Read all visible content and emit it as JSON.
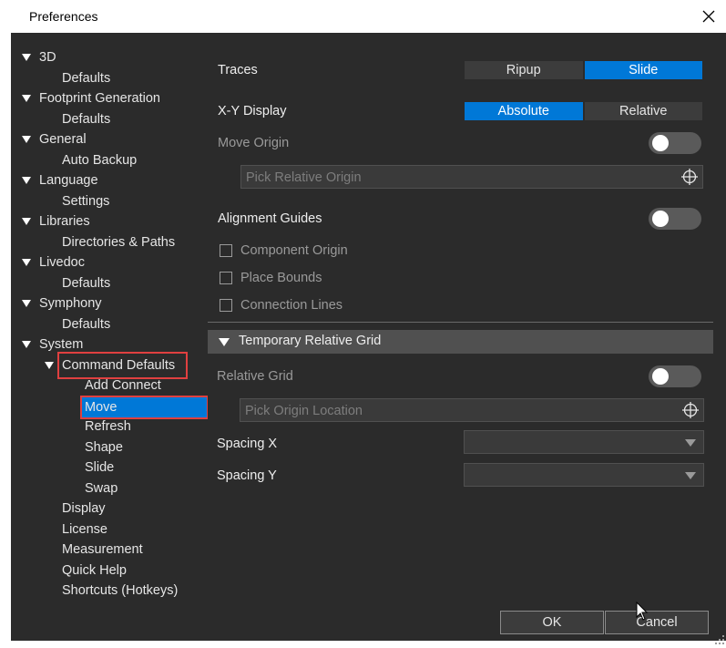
{
  "window": {
    "title": "Preferences"
  },
  "tree": {
    "items": [
      {
        "label": "3D"
      },
      {
        "label": "Defaults"
      },
      {
        "label": "Footprint Generation"
      },
      {
        "label": "Defaults"
      },
      {
        "label": "General"
      },
      {
        "label": "Auto Backup"
      },
      {
        "label": "Language"
      },
      {
        "label": "Settings"
      },
      {
        "label": "Libraries"
      },
      {
        "label": "Directories & Paths"
      },
      {
        "label": "Livedoc"
      },
      {
        "label": "Defaults"
      },
      {
        "label": "Symphony"
      },
      {
        "label": "Defaults"
      },
      {
        "label": "System"
      },
      {
        "label": "Command Defaults"
      },
      {
        "label": "Add Connect"
      },
      {
        "label": "Move"
      },
      {
        "label": "Refresh"
      },
      {
        "label": "Shape"
      },
      {
        "label": "Slide"
      },
      {
        "label": "Swap"
      },
      {
        "label": "Display"
      },
      {
        "label": "License"
      },
      {
        "label": "Measurement"
      },
      {
        "label": "Quick Help"
      },
      {
        "label": "Shortcuts (Hotkeys)"
      }
    ],
    "selected": "Move"
  },
  "move": {
    "traces_label": "Traces",
    "traces_options": [
      "Ripup",
      "Slide"
    ],
    "traces_selected": "Slide",
    "xy_label": "X-Y Display",
    "xy_options": [
      "Absolute",
      "Relative"
    ],
    "xy_selected": "Absolute",
    "move_origin_label": "Move Origin",
    "move_origin_on": false,
    "pick_relative_placeholder": "Pick Relative Origin",
    "alignment_label": "Alignment Guides",
    "alignment_on": false,
    "cb_component_origin": "Component Origin",
    "cb_place_bounds": "Place Bounds",
    "cb_connection_lines": "Connection Lines"
  },
  "grid": {
    "section_title": "Temporary Relative Grid",
    "relative_grid_label": "Relative Grid",
    "relative_grid_on": false,
    "pick_origin_placeholder": "Pick Origin Location",
    "spacing_x_label": "Spacing X",
    "spacing_x_value": "",
    "spacing_y_label": "Spacing Y",
    "spacing_y_value": ""
  },
  "footer": {
    "ok_label": "OK",
    "cancel_label": "Cancel"
  },
  "colors": {
    "accent": "#0078d7",
    "panel": "#2b2b2b",
    "highlight_box": "#e04040"
  }
}
